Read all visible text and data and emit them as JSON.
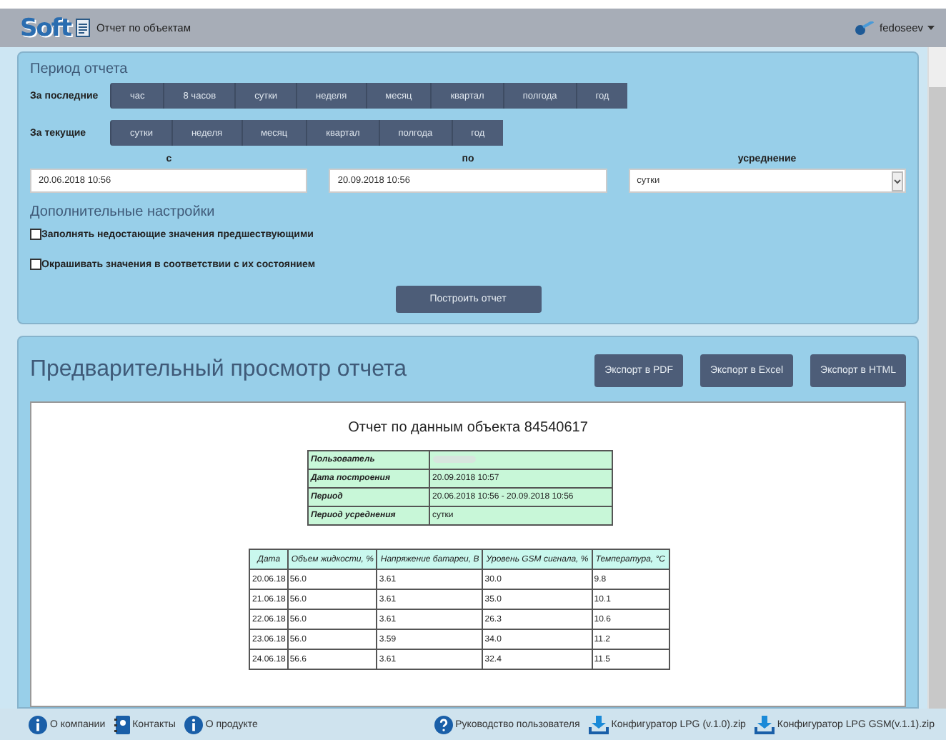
{
  "header": {
    "logo": "Soft",
    "title": "Отчет по объектам",
    "user": "fedoseev"
  },
  "period": {
    "title": "Период отчета",
    "last": {
      "label": "За последние",
      "options": [
        "час",
        "8 часов",
        "сутки",
        "неделя",
        "месяц",
        "квартал",
        "полгода",
        "год"
      ]
    },
    "current": {
      "label": "За текущие",
      "options": [
        "сутки",
        "неделя",
        "месяц",
        "квартал",
        "полгода",
        "год"
      ]
    },
    "from": {
      "label": "с",
      "value": "20.06.2018 10:56"
    },
    "to": {
      "label": "по",
      "value": "20.09.2018 10:56"
    },
    "averaging": {
      "label": "усреднение",
      "value": "сутки"
    },
    "extra_title": "Дополнительные настройки",
    "options": [
      {
        "label": "Заполнять недостающие значения предшествующими",
        "checked": false
      },
      {
        "label": "Окрашивать значения в соответствии с их состоянием",
        "checked": false
      }
    ],
    "build_button": "Построить отчет"
  },
  "preview": {
    "title": "Предварительный просмотр отчета",
    "exports": [
      "Экспорт в PDF",
      "Экспорт в Excel",
      "Экспорт в HTML"
    ],
    "report_title": "Отчет по данным объекта 84540617",
    "info": [
      {
        "label": "Пользователь"
      },
      {
        "label": "Дата построения",
        "value": "20.09.2018 10:57"
      },
      {
        "label": "Период",
        "value": "20.06.2018 10:56 - 20.09.2018 10:56"
      },
      {
        "label": "Период усреднения",
        "value": "сутки"
      }
    ],
    "table": {
      "columns": [
        "Дата",
        "Объем жидкости, %",
        "Напряжение батареи, В",
        "Уровень GSM сигнала, %",
        "Температура, °С"
      ],
      "rows": [
        [
          "20.06.18",
          "56.0",
          "3.61",
          "30.0",
          "9.8"
        ],
        [
          "21.06.18",
          "56.0",
          "3.61",
          "35.0",
          "10.1"
        ],
        [
          "22.06.18",
          "56.0",
          "3.61",
          "26.3",
          "10.6"
        ],
        [
          "23.06.18",
          "56.0",
          "3.59",
          "34.0",
          "11.2"
        ],
        [
          "24.06.18",
          "56.6",
          "3.61",
          "32.4",
          "11.5"
        ]
      ]
    }
  },
  "footer": {
    "links": [
      {
        "kind": "info",
        "label": "О компании"
      },
      {
        "kind": "contacts",
        "label": "Контакты"
      },
      {
        "kind": "info",
        "label": "О продукте"
      },
      {
        "kind": "help",
        "label": "Руководство пользователя"
      },
      {
        "kind": "download",
        "label": "Конфигуратор LPG (v.1.0).zip"
      },
      {
        "kind": "download",
        "label": "Конфигуратор LPG GSM(v.1.1).zip"
      }
    ]
  }
}
